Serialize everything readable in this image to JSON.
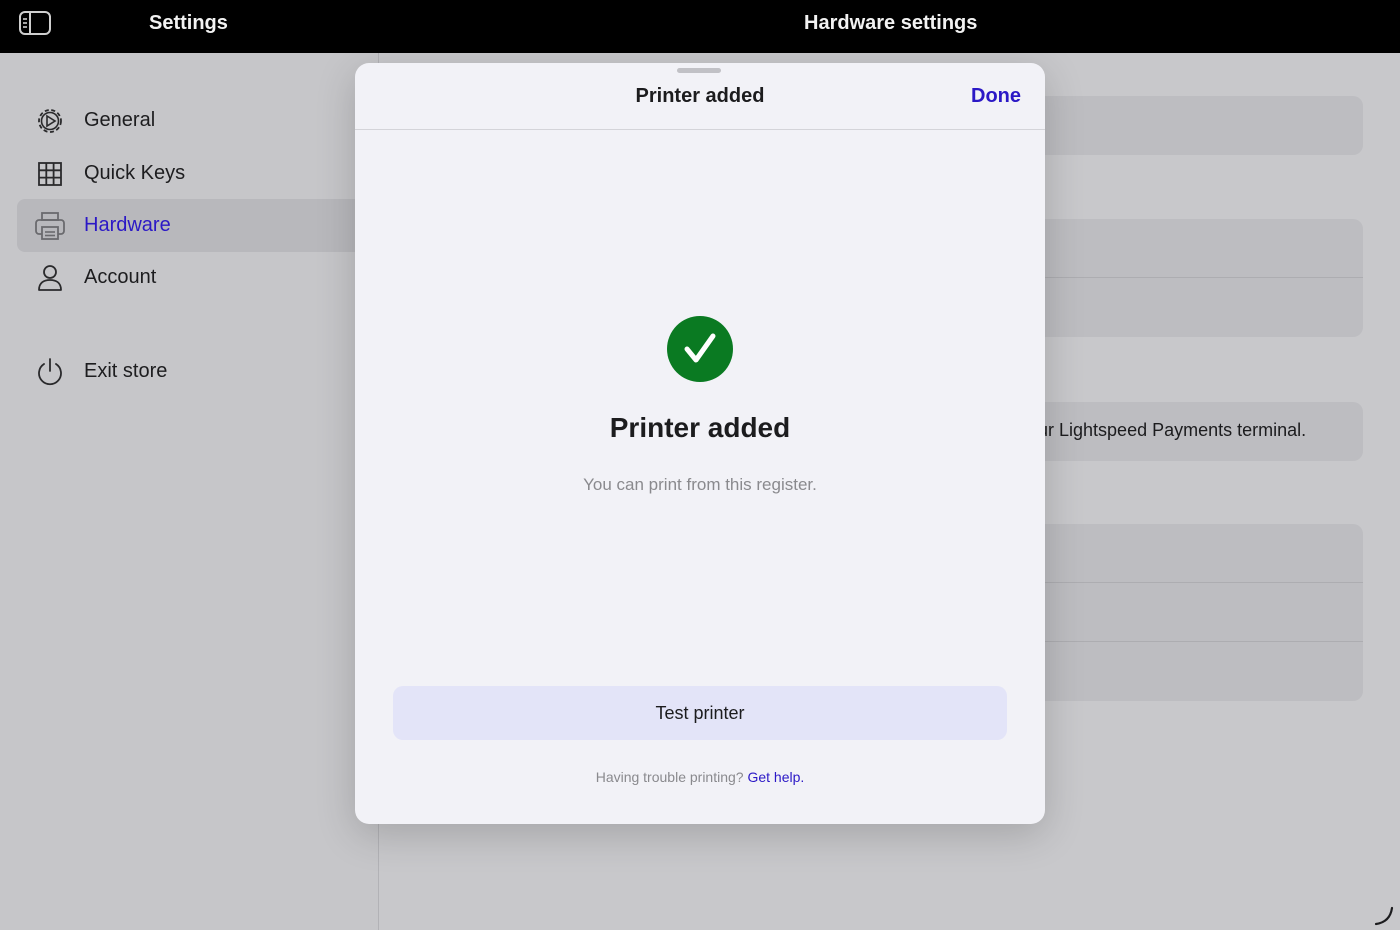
{
  "topbar": {
    "left_title": "Settings",
    "center_title": "Hardware settings"
  },
  "sidebar": {
    "items": [
      {
        "label": "General",
        "icon": "gear-icon"
      },
      {
        "label": "Quick Keys",
        "icon": "grid-icon"
      },
      {
        "label": "Hardware",
        "icon": "printer-icon",
        "active": true
      },
      {
        "label": "Account",
        "icon": "person-icon"
      }
    ],
    "exit": {
      "label": "Exit store",
      "icon": "power-icon"
    }
  },
  "content": {
    "visible_text": "our Lightspeed Payments terminal."
  },
  "modal": {
    "title": "Printer added",
    "done_label": "Done",
    "success_title": "Printer added",
    "success_subtitle": "You can print from this register.",
    "test_button_label": "Test printer",
    "help_text": "Having trouble printing?",
    "help_link": "Get help."
  },
  "colors": {
    "accent": "#2b18c6",
    "success": "#0a7a22",
    "topbar": "#000000"
  }
}
